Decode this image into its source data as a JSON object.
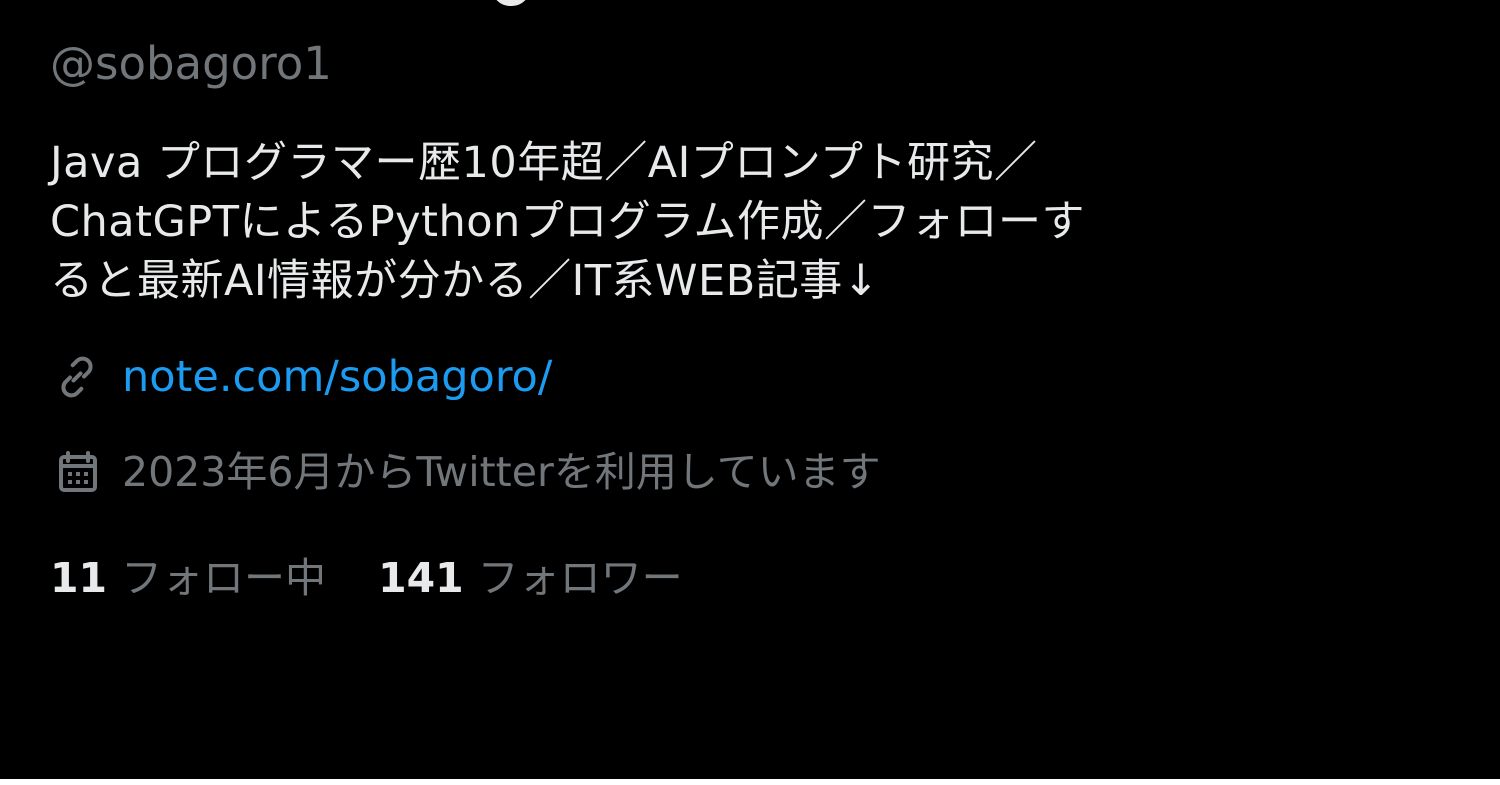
{
  "profile": {
    "handle": "@sobagoro1",
    "bio_lines": [
      "Java プログラマー歴10年超／AIプロンプト研究／",
      "ChatGPTによるPythonプログラム作成／フォローす",
      "ると最新AI情報が分かる／IT系WEB記事↓"
    ],
    "website": "note.com/sobagoro/",
    "joined": "2023年6月からTwitterを利用しています",
    "stats": {
      "following_count": "11",
      "following_label": "フォロー中",
      "followers_count": "141",
      "followers_label": "フォロワー"
    }
  },
  "icons": {
    "website_icon": "link-icon",
    "joined_icon": "calendar-icon"
  },
  "colors": {
    "background": "#000000",
    "primary_text": "#e7e9ea",
    "secondary_text": "#71767b",
    "link": "#1d9bf0"
  }
}
